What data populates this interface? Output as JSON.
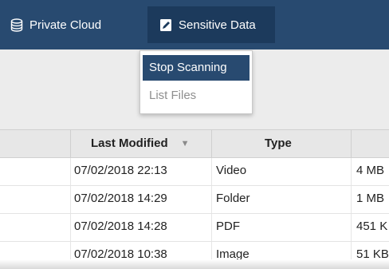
{
  "nav": {
    "items": [
      {
        "label": "Private Cloud",
        "icon": "database-icon"
      },
      {
        "label": "Sensitive Data",
        "icon": "document-edit-icon"
      }
    ],
    "bg_color": "#284a70",
    "active_bg_color": "#1c3a5c"
  },
  "dropdown": {
    "items": [
      {
        "label": "Stop Scanning",
        "highlighted": true
      },
      {
        "label": "List Files",
        "highlighted": false
      }
    ]
  },
  "table": {
    "columns": [
      {
        "label": "Last Modified",
        "sort": "descending"
      },
      {
        "label": "Type"
      }
    ],
    "rows": [
      {
        "modified": "07/02/2018 22:13",
        "type": "Video",
        "size": "4 MB"
      },
      {
        "modified": "07/02/2018 14:29",
        "type": "Folder",
        "size": "1 MB"
      },
      {
        "modified": "07/02/2018 14:28",
        "type": "PDF",
        "size": "451 K"
      },
      {
        "modified": "07/02/2018 10:38",
        "type": "Image",
        "size": "51 KB"
      }
    ]
  }
}
